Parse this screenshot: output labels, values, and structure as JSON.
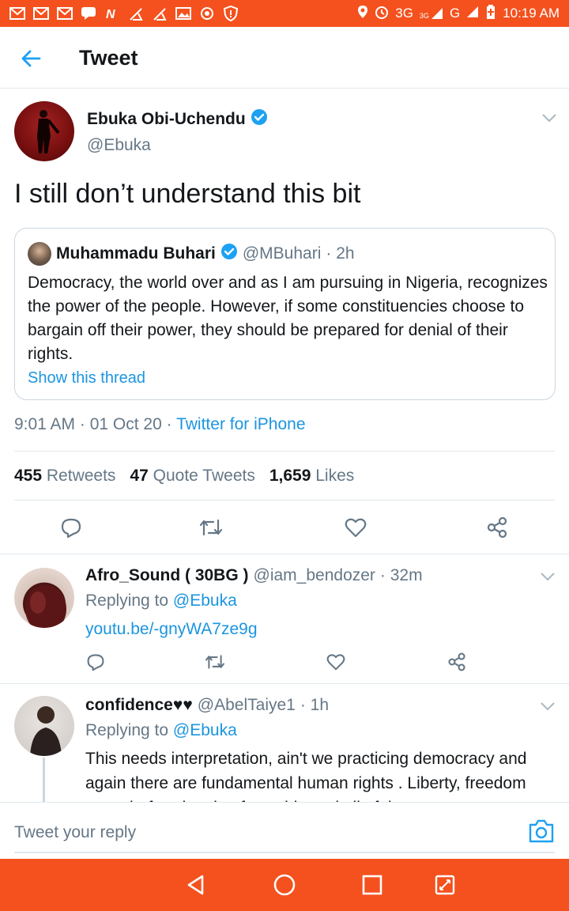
{
  "status_bar": {
    "network": "3G",
    "network_small": "3G",
    "network2": "G",
    "time": "10:19 AM"
  },
  "header": {
    "title": "Tweet"
  },
  "tweet": {
    "author_name": "Ebuka Obi-Uchendu",
    "handle": "@Ebuka",
    "text": "I still don’t understand this bit",
    "quote": {
      "author_name": "Muhammadu Buhari",
      "handle": "@MBuhari",
      "age": "· 2h",
      "text": "Democracy, the world over and as I am pursuing in Nigeria, recognizes the power of the people. However, if some constituencies choose to bargain off their power, they should be prepared for denial of their rights.",
      "show_thread": "Show this thread"
    },
    "time": "9:01 AM",
    "date": "· 01 Oct 20 ·",
    "source": "Twitter for iPhone",
    "stats": {
      "retweets_count": "455",
      "retweets_label": "Retweets",
      "quotes_count": "47",
      "quotes_label": "Quote Tweets",
      "likes_count": "1,659",
      "likes_label": "Likes"
    }
  },
  "replies": [
    {
      "author_name": "Afro_Sound ( 30BG )",
      "handle": "@iam_bendozer",
      "age": "· 32m",
      "replying_label": "Replying to",
      "replying_to": "@Ebuka",
      "link": "youtu.be/-gnyWA7ze9g"
    },
    {
      "author_name": "confidence♥♥",
      "handle": "@AbelTaiye1",
      "age": "· 1h",
      "replying_label": "Replying to",
      "replying_to": "@Ebuka",
      "text": "This needs interpretation, ain't we practicing democracy and again there are fundamental human rights . Liberty, freedom speech, freedom in of worship and all of that"
    }
  ],
  "composer": {
    "placeholder": "Tweet your reply"
  },
  "colors": {
    "accent": "#1da1f2",
    "link": "#1b95e0",
    "system_bar": "#f4511e",
    "muted": "#657786"
  },
  "icons": [
    "back-arrow-icon",
    "verified-badge-icon",
    "chevron-down-icon",
    "reply-icon",
    "retweet-icon",
    "like-icon",
    "share-icon",
    "camera-icon",
    "nav-back-icon",
    "nav-home-icon",
    "nav-recents-icon",
    "nav-screenshot-icon"
  ]
}
